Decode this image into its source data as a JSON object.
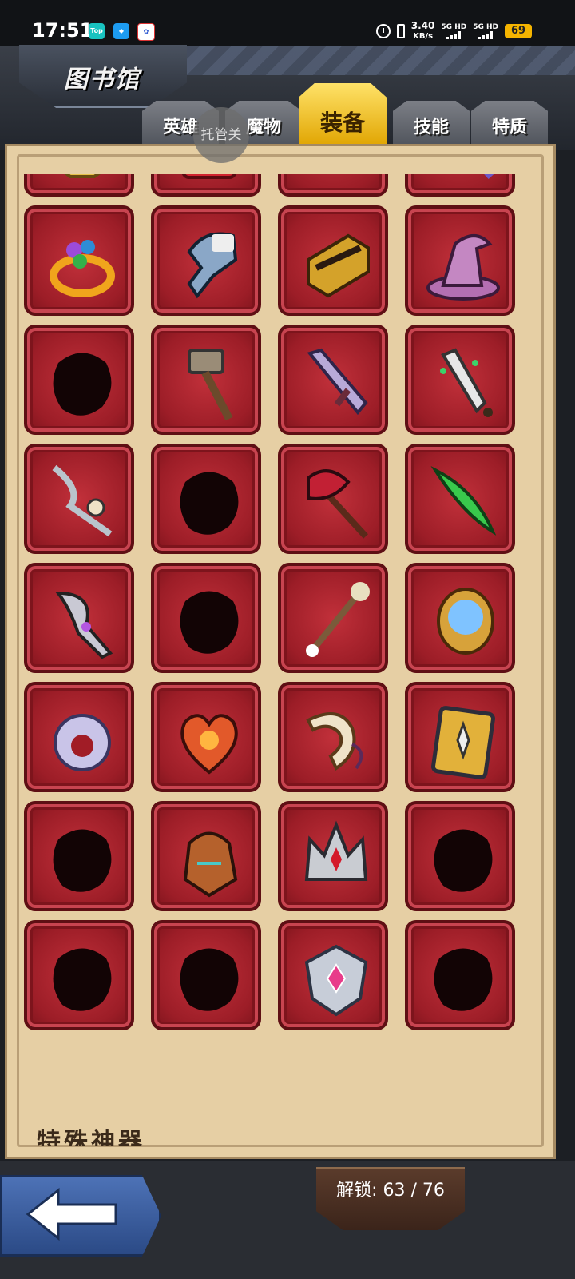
{
  "status_bar": {
    "time": "17:51",
    "apps": [
      "Top",
      "QQ",
      "Baidu"
    ],
    "net_speed_value": "3.40",
    "net_speed_unit": "KB/s",
    "sim1_label": "5G HD",
    "sim2_label": "5G HD",
    "battery": "69"
  },
  "header": {
    "title": "图书馆"
  },
  "tabs": [
    {
      "label": "英雄",
      "active": false
    },
    {
      "label": "魔物",
      "active": false
    },
    {
      "label": "装备",
      "active": true
    },
    {
      "label": "技能",
      "active": false
    },
    {
      "label": "特质",
      "active": false
    }
  ],
  "floating_button": "托管关",
  "grid": {
    "columns": 4,
    "items": [
      {
        "icon": "gold-helmet",
        "locked": false
      },
      {
        "icon": "red-book",
        "locked": false
      },
      {
        "icon": "ruby-amulet",
        "locked": false
      },
      {
        "icon": "gem-staff",
        "locked": false
      },
      {
        "icon": "gem-ring",
        "locked": false
      },
      {
        "icon": "spectral-gauntlet",
        "locked": false
      },
      {
        "icon": "gold-bracer",
        "locked": false
      },
      {
        "icon": "witch-hat",
        "locked": false
      },
      {
        "icon": "unknown-silhouette",
        "locked": true
      },
      {
        "icon": "hammer",
        "locked": false
      },
      {
        "icon": "purple-greatsword",
        "locked": false
      },
      {
        "icon": "green-dagger",
        "locked": false
      },
      {
        "icon": "bone-blade",
        "locked": false
      },
      {
        "icon": "unknown-silhouette",
        "locked": true
      },
      {
        "icon": "crimson-axe",
        "locked": false
      },
      {
        "icon": "emerald-blade",
        "locked": false
      },
      {
        "icon": "curved-dagger",
        "locked": false
      },
      {
        "icon": "unknown-silhouette",
        "locked": true
      },
      {
        "icon": "lily-staff",
        "locked": false
      },
      {
        "icon": "sapphire-orb",
        "locked": false
      },
      {
        "icon": "crystal-ring",
        "locked": false
      },
      {
        "icon": "molten-heart",
        "locked": false
      },
      {
        "icon": "war-horn",
        "locked": false
      },
      {
        "icon": "spiked-shield",
        "locked": false
      },
      {
        "icon": "unknown-silhouette",
        "locked": true
      },
      {
        "icon": "bronze-helm",
        "locked": false
      },
      {
        "icon": "silver-crown",
        "locked": false
      },
      {
        "icon": "unknown-silhouette",
        "locked": true
      },
      {
        "icon": "unknown-silhouette",
        "locked": true
      },
      {
        "icon": "unknown-silhouette",
        "locked": true
      },
      {
        "icon": "jeweled-crest",
        "locked": false
      },
      {
        "icon": "unknown-silhouette",
        "locked": true
      }
    ]
  },
  "next_section_title": "特殊神器",
  "unlock": {
    "label": "解锁:",
    "value": "63 / 76"
  },
  "colors": {
    "tile_red": "#a8222c",
    "tab_active": "#f2c21a",
    "panel": "#e6cfa4",
    "back_button": "#3c5e9e"
  }
}
